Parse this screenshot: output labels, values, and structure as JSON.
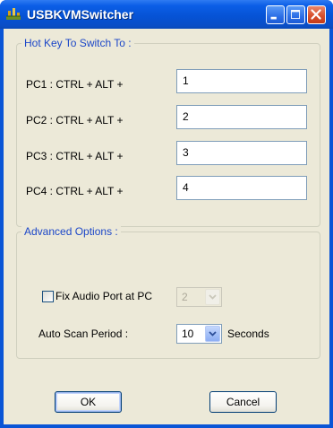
{
  "window": {
    "title": "USBKVMSwitcher",
    "icon": "app-network-icon",
    "controls": [
      "minimize-icon",
      "maximize-icon",
      "close-icon"
    ]
  },
  "hotkey_group": {
    "legend": "Hot Key To Switch To :",
    "rows": [
      {
        "label": "PC1 :  CTRL  +  ALT  +",
        "value": "1"
      },
      {
        "label": "PC2 :  CTRL  +  ALT  +",
        "value": "2"
      },
      {
        "label": "PC3 :  CTRL  +  ALT  +",
        "value": "3"
      },
      {
        "label": "PC4 :  CTRL  +  ALT  +",
        "value": "4"
      }
    ]
  },
  "advanced_group": {
    "legend": "Advanced Options :",
    "fix_audio": {
      "label": "Fix Audio Port at PC",
      "checked": false,
      "selected": "2",
      "enabled": false
    },
    "auto_scan": {
      "label": "Auto Scan Period :",
      "selected": "10",
      "unit": "Seconds"
    }
  },
  "buttons": {
    "ok": "OK",
    "cancel": "Cancel"
  },
  "colors": {
    "titlebar": "#0a55d6",
    "legend_text": "#1c47c8",
    "client_bg": "#ece9d8"
  }
}
